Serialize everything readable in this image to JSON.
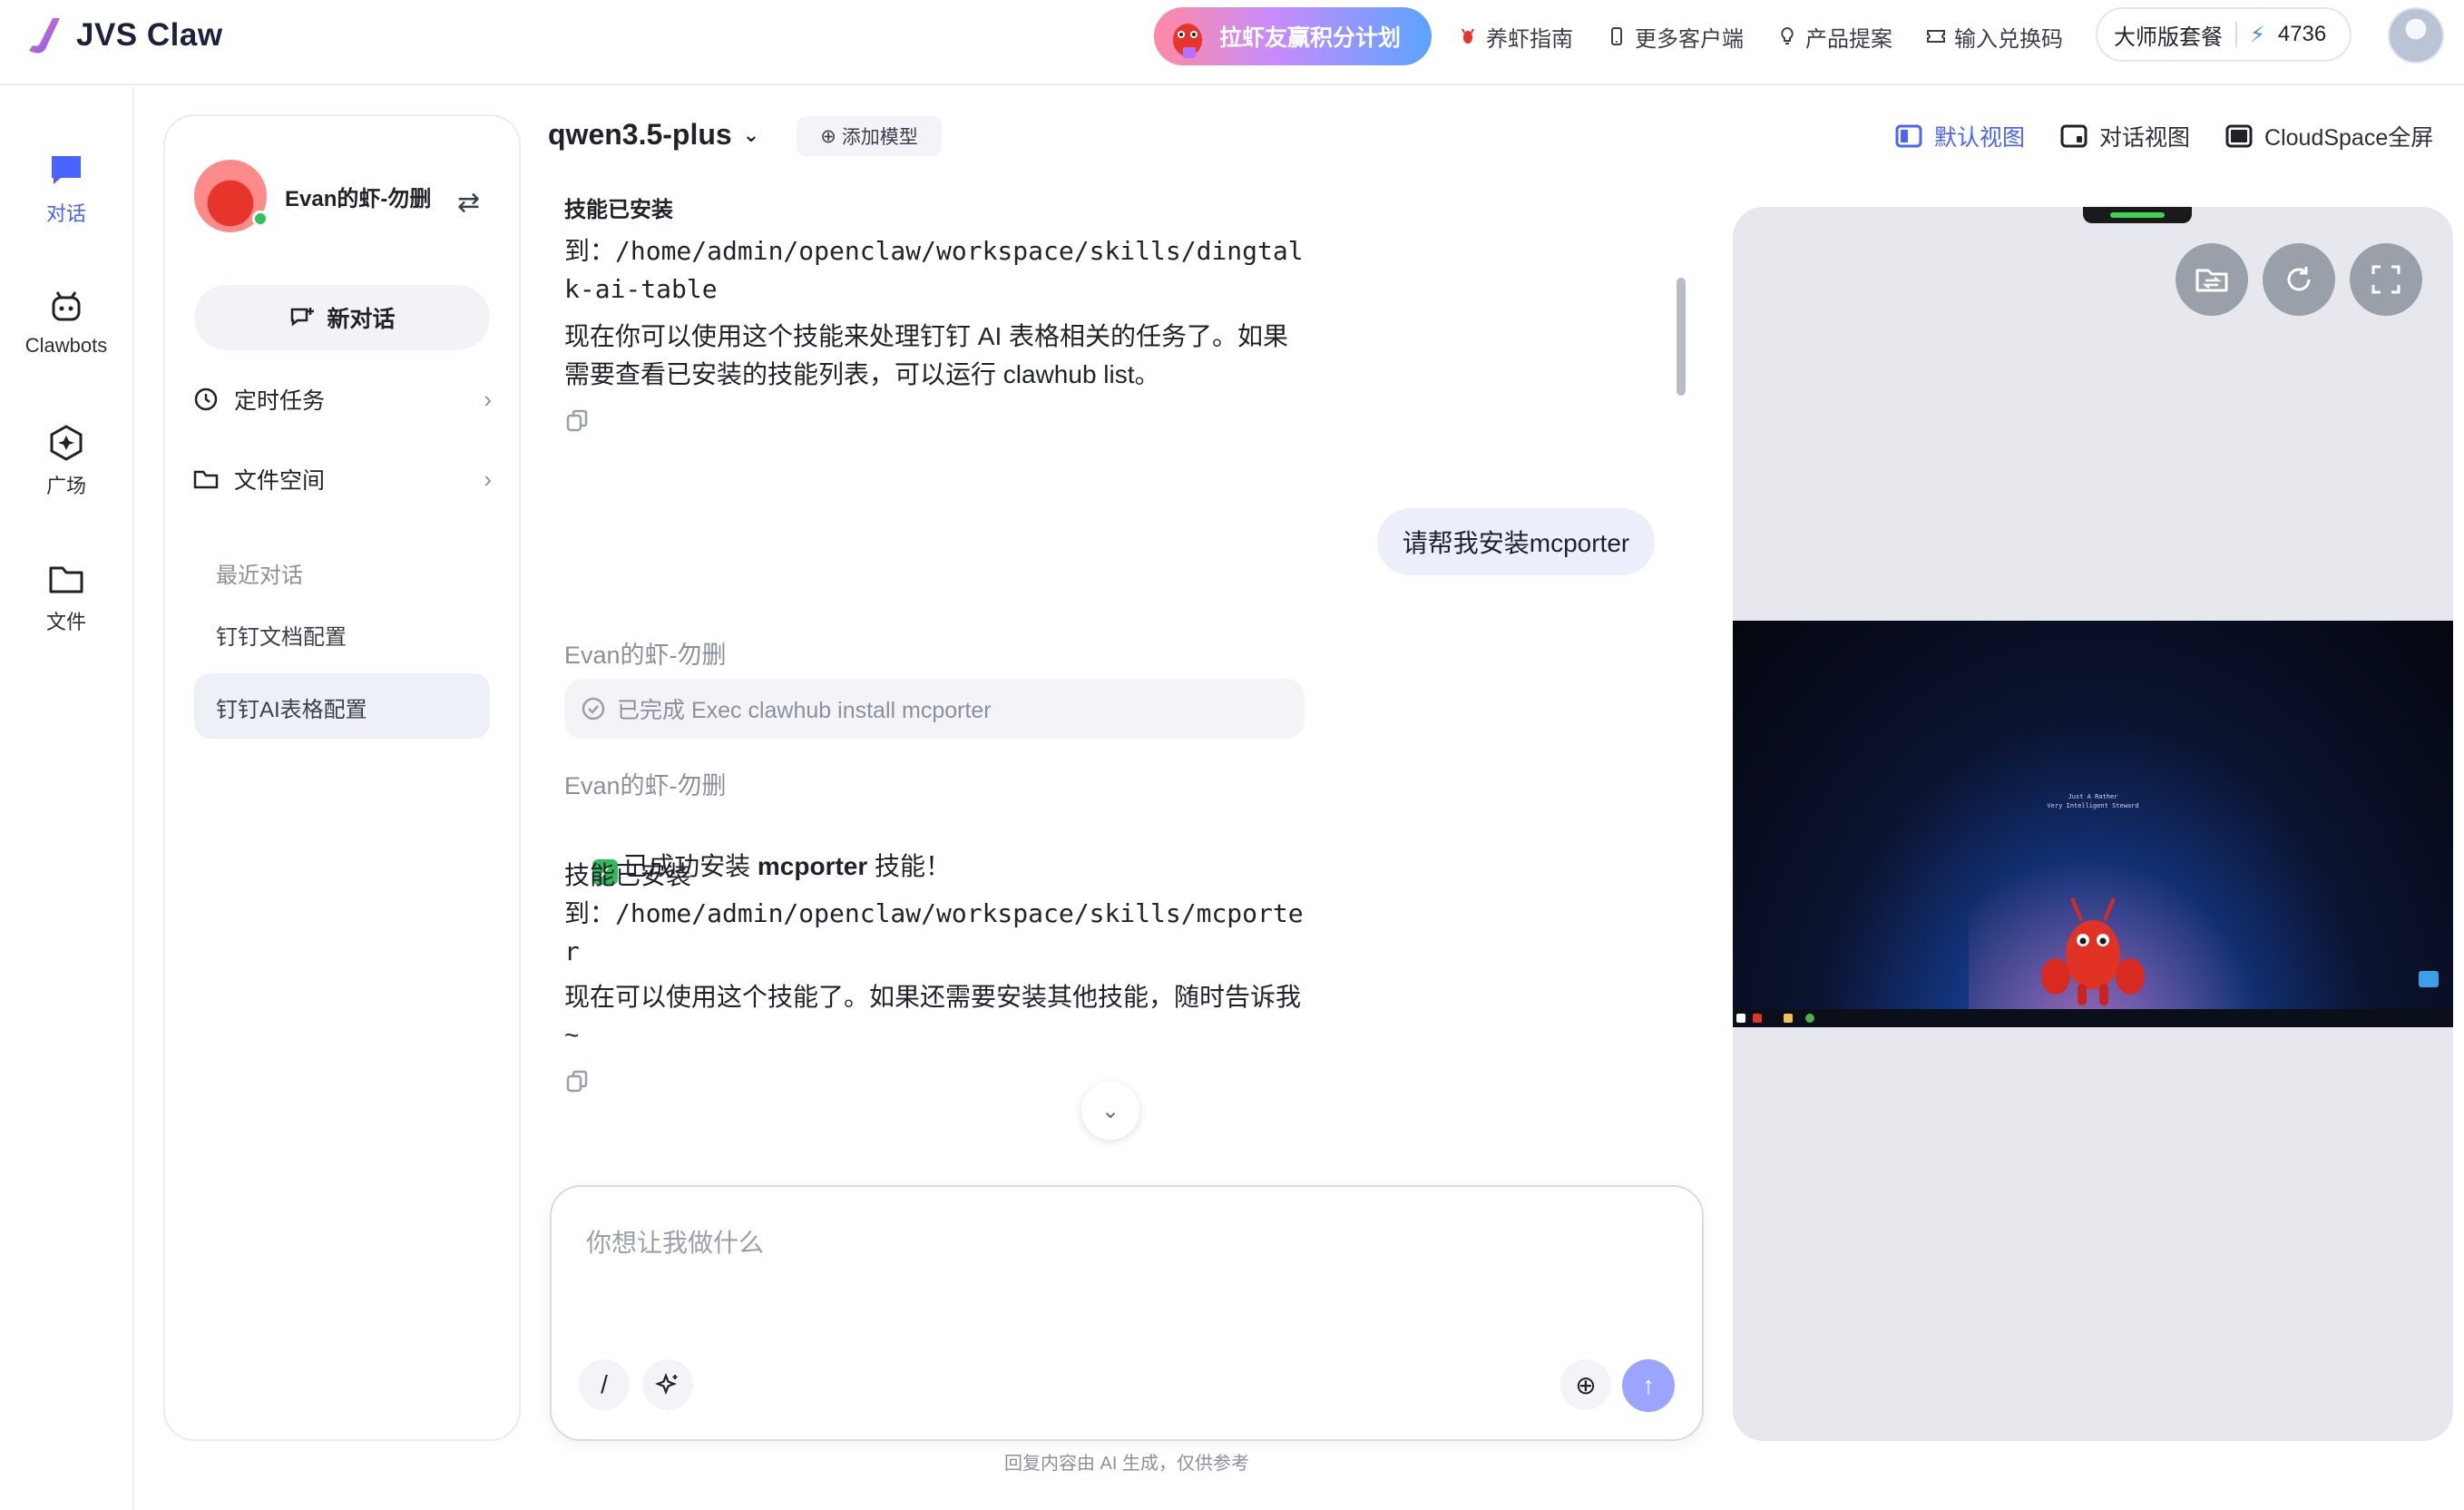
{
  "app": {
    "title": "JVS Claw"
  },
  "topbar": {
    "promo_label": "拉虾友赢积分计划",
    "nav": [
      {
        "label": "养虾指南",
        "icon": "lobster-icon"
      },
      {
        "label": "更多客户端",
        "icon": "phone-icon"
      },
      {
        "label": "产品提案",
        "icon": "lightbulb-icon"
      },
      {
        "label": "输入兑换码",
        "icon": "ticket-icon"
      }
    ],
    "plan_label": "大师版套餐",
    "points": "4736"
  },
  "rail": [
    {
      "label": "对话",
      "icon": "chat-icon",
      "active": true
    },
    {
      "label": "Clawbots",
      "icon": "bot-icon",
      "active": false
    },
    {
      "label": "广场",
      "icon": "plaza-icon",
      "active": false
    },
    {
      "label": "文件",
      "icon": "folder-icon",
      "active": false
    }
  ],
  "sidebar": {
    "user_name": "Evan的虾-勿删",
    "new_chat": "新对话",
    "scheduled_tasks": "定时任务",
    "file_space": "文件空间",
    "recent_label": "最近对话",
    "recent": [
      "钉钉文档配置",
      "钉钉AI表格配置"
    ]
  },
  "chat": {
    "model_name": "qwen3.5-plus",
    "add_model": "添加模型",
    "views": [
      {
        "label": "默认视图",
        "active": true
      },
      {
        "label": "对话视图",
        "active": false
      },
      {
        "label": "CloudSpace全屏",
        "active": false
      }
    ],
    "messages": {
      "m1_line1": "技能已安装",
      "m1_line2": "到：/home/admin/openclaw/workspace/skills/dingtal",
      "m1_line3": "k-ai-table",
      "m1_line4": "现在你可以使用这个技能来处理钉钉 AI 表格相关的任务了。如果",
      "m1_line5": "需要查看已安装的技能列表，可以运行 clawhub list。",
      "user_msg": "请帮我安装mcporter",
      "bot_name_1": "Evan的虾-勿删",
      "exec_status": "已完成 Exec clawhub install mcporter",
      "bot_name_2": "Evan的虾-勿删",
      "m2_success_prefix": "已成功安装 ",
      "m2_success_bold": "mcporter",
      "m2_success_suffix": " 技能！",
      "m2_line2": "技能已安装",
      "m2_line3": "到：/home/admin/openclaw/workspace/skills/mcporte",
      "m2_line4": "r",
      "m2_line5": "现在可以使用这个技能了。如果还需要安装其他技能，随时告诉我",
      "m2_line6": "~"
    },
    "composer_placeholder": "你想让我做什么",
    "disclaimer": "回复内容由 AI 生成，仅供参考"
  },
  "cloudspace": {
    "desktop_caption_1": "Just A Rather",
    "desktop_caption_2": "Very Intelligent Steward"
  },
  "colors": {
    "accent": "#4a63ff",
    "send": "#9ba4ff",
    "panel": "#e6e8ee"
  }
}
